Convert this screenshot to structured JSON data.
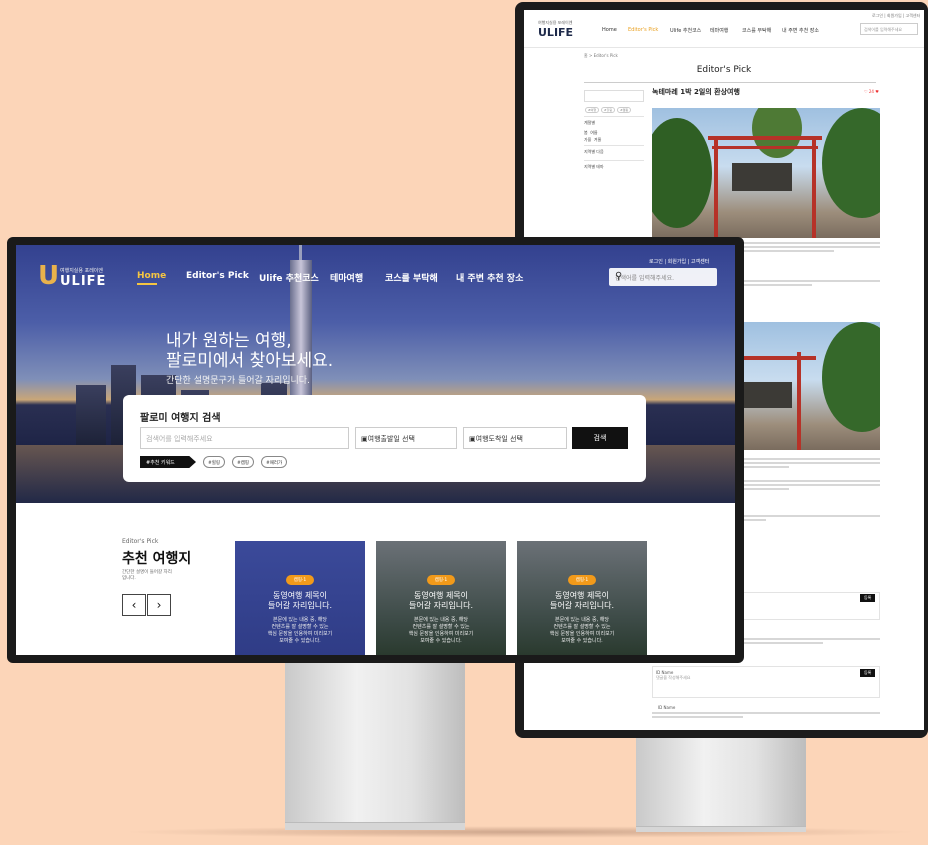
{
  "back": {
    "logo_sub": "여행지실용 포레이엔",
    "logo": "ULIFE",
    "nav": [
      "Home",
      "Editor's Pick",
      "Ulife 추천코스",
      "테마여행",
      "코스를 부탁해",
      "내 주변 추천 장소"
    ],
    "util": "로그인 | 회원가입 | 고객센터",
    "search_placeholder": "검색어를 입력해주세요",
    "breadcrumb": "홈 > Editor's Pick",
    "page_title": "Editor's Pick",
    "side_sections": [
      "계절별",
      "지역별 다음",
      "지역별 테마"
    ],
    "season_options": [
      "봄",
      "여름",
      "가을",
      "겨울"
    ],
    "post_title": "녹테마레 1박 2일의 환상여행",
    "like_count": "♡ 24 ♥",
    "tags": [
      "#여행",
      "#힐링",
      "#캠핑"
    ],
    "comment_name": "ID Name",
    "comment_text": "댓글을 작성해주세요",
    "comment_btn": "등록"
  },
  "front": {
    "logo_sub": "여행지실용 포레이엔",
    "logo": "ULIFE",
    "nav": [
      "Home",
      "Editor's Pick",
      "Ulife 추천코스",
      "테마여행",
      "코스를 부탁해",
      "내 주변 추천 장소"
    ],
    "util": "로그인  |  회원가입  |  고객센터",
    "search_placeholder": "검색어를 입력해주세요.",
    "hero_title": "내가 원하는 여행,\n팔로미에서 찾아보세요.",
    "hero_sub": "간단한 설명문구가 들어갈 자리입니다.",
    "search_panel_title": "팔로미 여행지 검색",
    "search_input_placeholder": "검색어를 입력해주세요",
    "depart_date": "여행출발일 선택",
    "arrive_date": "여행도착일 선택",
    "search_button": "검색",
    "keywords_label": "#추천 키워드",
    "keywords": [
      "#힐링",
      "#캠핑",
      "#패러가"
    ],
    "section_small": "Editor's Pick",
    "section_title": "추천 여행지",
    "section_desc": "간단한 설명이 들어갈 자리 입니다.",
    "prev_icon": "‹",
    "next_icon": "›",
    "cards": [
      {
        "badge": "캠핑·1",
        "title": "동영여행 제목이\n들어갈 자리입니다.",
        "desc": "본문에 있는 내용 중, 해당\n컨텐츠를 잘 설명할 수 있는\n핵심 문장을 인용하여 미리보기\n보여줄 수 있습니다."
      },
      {
        "badge": "캠핑·1",
        "title": "동영여행 제목이\n들어갈 자리입니다.",
        "desc": "본문에 있는 내용 중, 해당\n컨텐츠를 잘 설명할 수 있는\n핵심 문장을 인용하여 미리보기\n보여줄 수 있습니다."
      },
      {
        "badge": "캠핑·1",
        "title": "동영여행 제목이\n들어갈 자리입니다.",
        "desc": "본문에 있는 내용 중, 해당\n컨텐츠를 잘 설명할 수 있는\n핵심 문장을 인용하여 미리보기\n보여줄 수 있습니다."
      }
    ]
  },
  "colors": {
    "accent": "#f5c542",
    "badge": "#f29a1a",
    "background": "#fcd5b8"
  }
}
